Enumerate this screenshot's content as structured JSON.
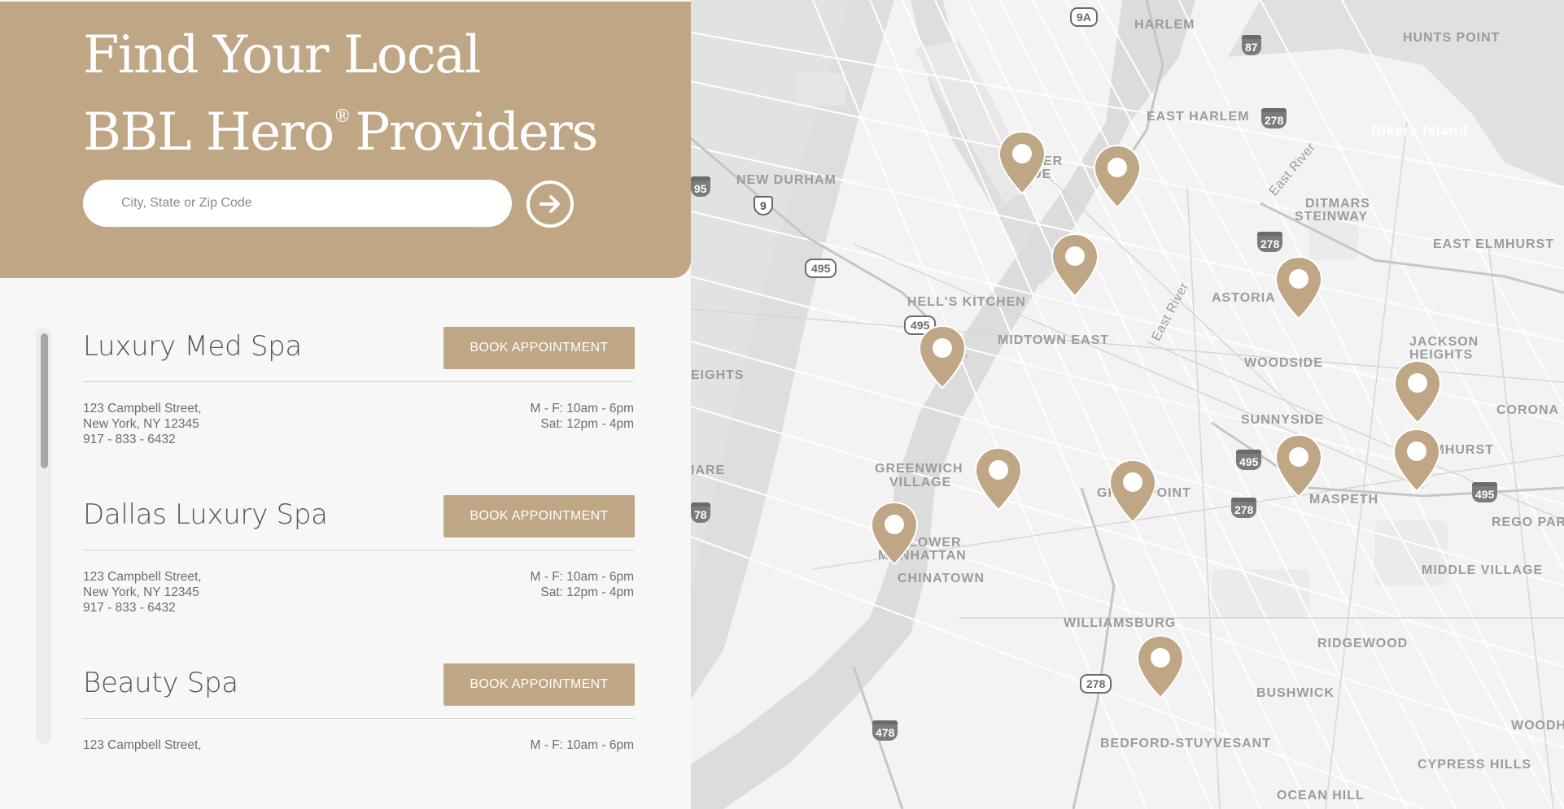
{
  "hero": {
    "title_line1": "Find Your Local",
    "title_line2_a": "BBL Hero",
    "title_line2_reg": "®",
    "title_line2_b": "Providers",
    "search_placeholder": "City, State or Zip Code",
    "submit_icon": "arrow-right-circle-icon"
  },
  "providers": [
    {
      "name": "Luxury Med Spa",
      "button_label": "BOOK APPOINTMENT",
      "address_line1": "123 Campbell Street,",
      "address_line2": "New York, NY 12345",
      "phone": "917 - 833 - 6432",
      "hours_weekday": "M - F: 10am - 6pm",
      "hours_saturday": "Sat: 12pm - 4pm"
    },
    {
      "name": "Dallas Luxury Spa",
      "button_label": "BOOK APPOINTMENT",
      "address_line1": "123 Campbell Street,",
      "address_line2": "New York, NY 12345",
      "phone": "917 - 833 - 6432",
      "hours_weekday": "M - F: 10am - 6pm",
      "hours_saturday": "Sat: 12pm - 4pm"
    },
    {
      "name": "Beauty Spa",
      "button_label": "BOOK APPOINTMENT",
      "address_line1": "123 Campbell Street,",
      "hours_weekday": "M - F: 10am - 6pm"
    }
  ],
  "map": {
    "pin_color": "#bfa684",
    "labels": [
      "HARLEM",
      "HUNTS POINT",
      "EAST HARLEM",
      "UPPER",
      "SIDE",
      "NEW DURHAM",
      "DITMARS",
      "STEINWAY",
      "EAST ELMHURST",
      "HELL'S KITCHEN",
      "ASTORIA",
      "MIDTOWN EAST",
      "EIGHTS",
      "WOODSIDE",
      "JACKSON",
      "HEIGHTS",
      "CORONA",
      "SUNNYSIDE",
      "ELMHURST",
      "GREENWICH",
      "VILLAGE",
      "IARE",
      "MASPETH",
      "GREENPOINT",
      "REGO PAR",
      "LOWER",
      "MANHATTAN",
      "CHINATOWN",
      "MIDDLE VILLAGE",
      "WILLIAMSBURG",
      "RIDGEWOOD",
      "BUSHWICK",
      "BEDFORD-STUYVESANT",
      "CYPRESS HILLS",
      "OCEAN HILL",
      "WOODH",
      "Rikers Island"
    ],
    "rivers": [
      "East River",
      "East River"
    ],
    "shields": [
      "9A",
      "87",
      "278",
      "95",
      "9",
      "495",
      "278",
      "495",
      "495",
      "278",
      "495",
      "78",
      "278",
      "478",
      "278"
    ]
  }
}
